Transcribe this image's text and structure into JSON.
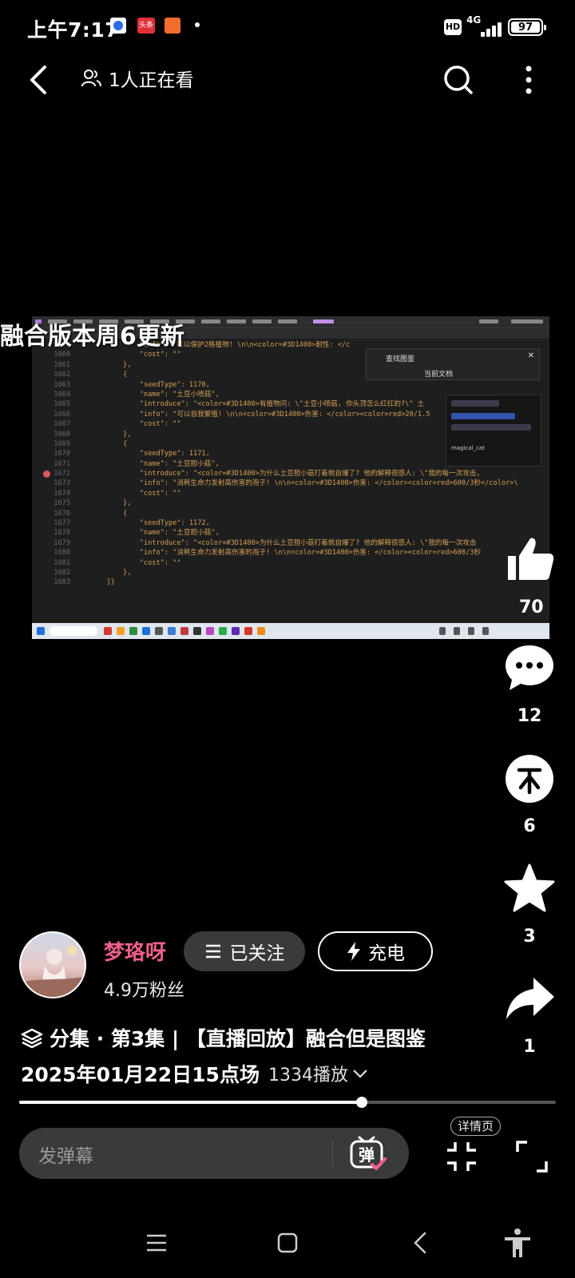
{
  "status_bar": {
    "time": "上午7:17",
    "toutiao_badge": "头条",
    "hd_label": "HD",
    "network": "4G",
    "battery": "97"
  },
  "top_bar": {
    "viewers_text": "1人正在看"
  },
  "video": {
    "overlay_title": "融合版本周6更新",
    "code_lines": [
      {
        "n": "1659",
        "code": "                \"info\": \"可以保护2格植物! \\n\\n<color=#3D1400>耐性: </c"
      },
      {
        "n": "1660",
        "code": "                \"cost\": \"\""
      },
      {
        "n": "1661",
        "code": "            },"
      },
      {
        "n": "1662",
        "code": "            {"
      },
      {
        "n": "1663",
        "code": "                \"seedType\": 1170,"
      },
      {
        "n": "1664",
        "code": "                \"name\": \"土豆小喷菇\","
      },
      {
        "n": "1665",
        "code": "                \"introduce\": \"<color=#3D1400>有植物问: \\\"土豆小喷菇, 你头顶怎么红红的?\\\" 土"
      },
      {
        "n": "1666",
        "code": "                \"info\": \"可以自我繁殖! \\n\\n<color=#3D1400>伤害: </color><color=red>20/1.5"
      },
      {
        "n": "1667",
        "code": "                \"cost\": \"\""
      },
      {
        "n": "1668",
        "code": "            },"
      },
      {
        "n": "1669",
        "code": "            {"
      },
      {
        "n": "1670",
        "code": "                \"seedType\": 1171,"
      },
      {
        "n": "1671",
        "code": "                \"name\": \"土豆胆小菇\","
      },
      {
        "n": "1672",
        "code": "                \"introduce\": \"<color=#3D1400>为什么土豆胆小菇打着就自爆了? 他的解释很感人: \\\"我的每一次攻击,"
      },
      {
        "n": "1673",
        "code": "                \"info\": \"消耗生命力发射高伤害的孢子! \\n\\n<color=#3D1400>伤害: </color><color=red>600/3秒</color>\\"
      },
      {
        "n": "1674",
        "code": "                \"cost\": \"\""
      },
      {
        "n": "1675",
        "code": "            },"
      },
      {
        "n": "1676",
        "code": "            {"
      },
      {
        "n": "1677",
        "code": "                \"seedType\": 1172,"
      },
      {
        "n": "1678",
        "code": "                \"name\": \"土豆胆小菇\","
      },
      {
        "n": "1679",
        "code": "                \"introduce\": \"<color=#3D1400>为什么土豆胆小菇打着就自爆了? 他的解释很感人: \\\"我的每一次攻击"
      },
      {
        "n": "1680",
        "code": "                \"info\": \"消耗生命力发射高伤害的孢子! \\n\\n<color=#3D1400>伤害: </color><color=red>600/3秒"
      },
      {
        "n": "1681",
        "code": "                \"cost\": \"\""
      },
      {
        "n": "1682",
        "code": "            },"
      },
      {
        "n": "1683",
        "code": "        ]}"
      }
    ],
    "find_panel": {
      "title": "查找图鉴",
      "scope": "当前文档"
    },
    "chat": {
      "user": "magical_cat"
    }
  },
  "rail": {
    "like_count": "70",
    "comment_count": "12",
    "coin_count": "6",
    "favorite_count": "3",
    "share_count": "1"
  },
  "author": {
    "name": "梦珞呀",
    "fans": "4.9万粉丝",
    "follow_label": "已关注",
    "charge_label": "充电"
  },
  "episode": {
    "line1": "分集 · 第3集 | 【直播回放】融合但是图鉴",
    "line2": "2025年01月22日15点场",
    "plays": "1334播放"
  },
  "progress": {
    "fraction": 0.638
  },
  "danmaku": {
    "placeholder": "发弹幕",
    "toggle_label": "弹",
    "detail_label": "详情页"
  },
  "colors": {
    "accent_pink": "#f0608a",
    "background": "#000000",
    "pill": "#3a3a3a"
  },
  "icons": [
    "back-icon",
    "viewers-icon",
    "search-icon",
    "more-icon",
    "like-icon",
    "comment-icon",
    "coin-icon",
    "star-icon",
    "share-icon",
    "list-icon",
    "lightning-icon",
    "layers-icon",
    "chevron-down-icon",
    "pip-icon",
    "fullscreen-icon",
    "menu-icon",
    "home-icon",
    "nav-back-icon",
    "accessibility-icon"
  ]
}
